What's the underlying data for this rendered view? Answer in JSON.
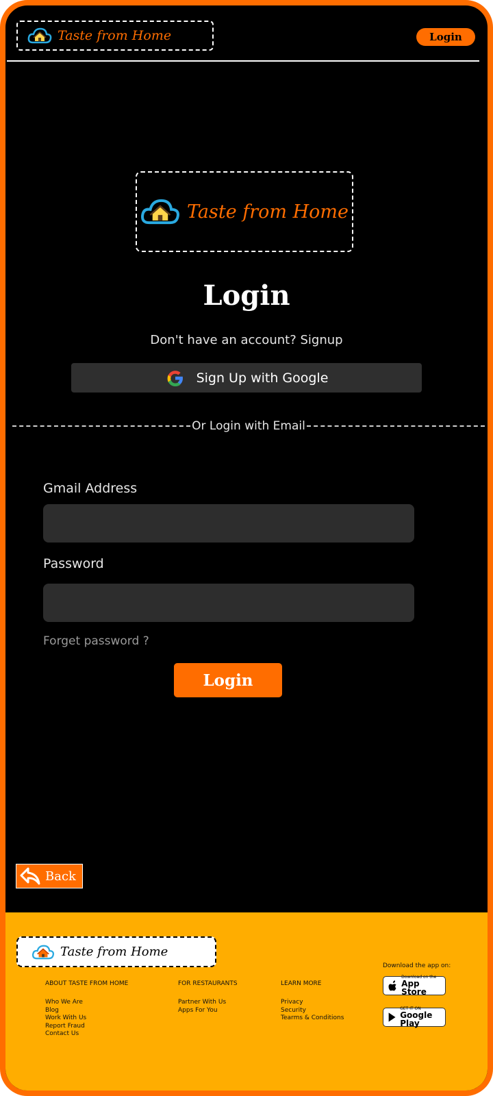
{
  "brand": {
    "name": "Taste from Home",
    "accent": "#ff6d00",
    "footer_bg": "#ffad00"
  },
  "header": {
    "login_label": "Login"
  },
  "main": {
    "title": "Login",
    "signup_prompt": "Don't have an account? Signup",
    "google_button": "Sign Up with Google",
    "divider_text": "Or Login with Email",
    "email_label": "Gmail Address",
    "email_value": "",
    "password_label": "Password",
    "password_value": "",
    "forgot_password": "Forget password ?",
    "login_button": "Login",
    "back_button": "Back"
  },
  "footer": {
    "columns": [
      {
        "heading": "ABOUT TASTE FROM HOME",
        "links": [
          "Who We Are",
          "Blog",
          "Work With Us",
          "Report Fraud",
          "Contact Us"
        ]
      },
      {
        "heading": "FOR RESTAURANTS",
        "links": [
          "Partner With Us",
          "Apps For You"
        ]
      },
      {
        "heading": "LEARN MORE",
        "links": [
          "Privacy",
          "Security",
          "Tearms & Conditions"
        ]
      }
    ],
    "download_label": "Download the app on:",
    "app_store": {
      "small": "Download on the",
      "big": "App Store"
    },
    "google_play": {
      "small": "GET IT ON",
      "big": "Google Play"
    }
  },
  "icons": [
    "cloud-house-icon",
    "google-icon",
    "back-arrow-icon",
    "apple-icon",
    "play-icon"
  ]
}
